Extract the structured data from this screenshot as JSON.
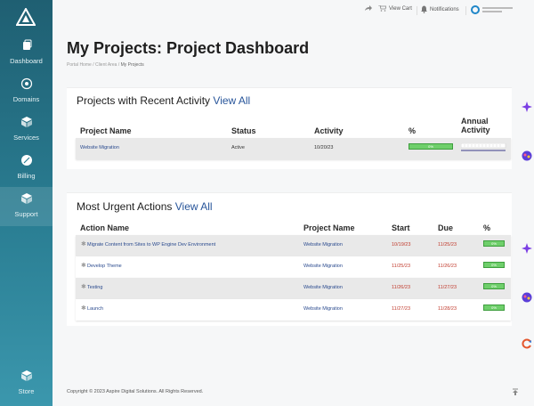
{
  "sidebar": {
    "items": [
      {
        "label": "Dashboard",
        "icon": "dashboard-icon"
      },
      {
        "label": "Domains",
        "icon": "globe-icon"
      },
      {
        "label": "Services",
        "icon": "box-icon"
      },
      {
        "label": "Billing",
        "icon": "leaf-icon"
      },
      {
        "label": "Support",
        "icon": "support-icon",
        "active": true
      }
    ],
    "store_label": "Store"
  },
  "topbar": {
    "view_cart": "View Cart",
    "notifications": "Notifications"
  },
  "page": {
    "title": "My Projects: Project Dashboard",
    "breadcrumb": [
      "Portal Home",
      "Client Area",
      "My Projects"
    ]
  },
  "recent": {
    "heading": "Projects with Recent Activity",
    "view_all": "View All",
    "columns": [
      "Project Name",
      "Status",
      "Activity",
      "%",
      "Annual Activity"
    ],
    "rows": [
      {
        "name": "Website Migration",
        "status": "Active",
        "activity": "10/20/23",
        "percent": "0%",
        "percent_value": 0
      }
    ]
  },
  "urgent": {
    "heading": "Most Urgent Actions",
    "view_all": "View All",
    "columns": [
      "Action Name",
      "Project Name",
      "Start",
      "Due",
      "%"
    ],
    "rows": [
      {
        "action": "Migrate Content from Sites to WP Engine Dev Environment",
        "project": "Website Migration",
        "start": "10/19/23",
        "due": "11/25/23",
        "percent": "0%"
      },
      {
        "action": "Develop Theme",
        "project": "Website Migration",
        "start": "11/25/23",
        "due": "11/26/23",
        "percent": "0%"
      },
      {
        "action": "Testing",
        "project": "Website Migration",
        "start": "11/26/23",
        "due": "11/27/23",
        "percent": "0%"
      },
      {
        "action": "Launch",
        "project": "Website Migration",
        "start": "11/27/23",
        "due": "11/28/23",
        "percent": "0%"
      }
    ]
  },
  "footer": {
    "copyright": "Copyright © 2023 Aspire Digital Solutions. All Rights Reserved."
  },
  "colors": {
    "sidebar_top": "#1f5f72",
    "sidebar_bottom": "#3b97ad",
    "accent": "#28559a",
    "due_red": "#c0392b",
    "progress_green": "#6fcf6b"
  }
}
